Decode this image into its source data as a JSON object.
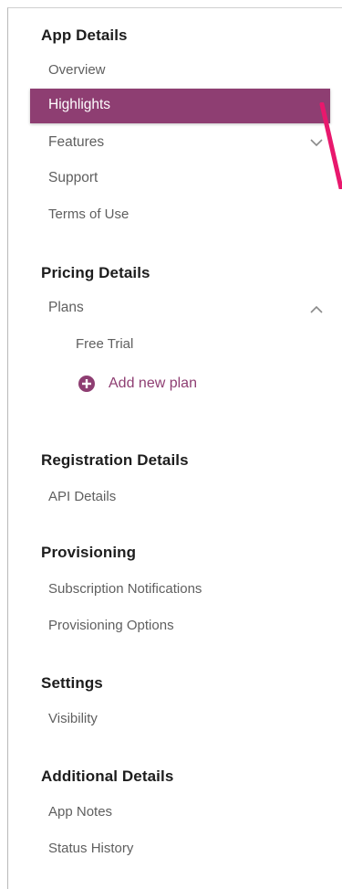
{
  "sections": {
    "app_details": {
      "title": "App Details",
      "items": [
        "Overview",
        "Highlights",
        "Features",
        "Support",
        "Terms of Use"
      ]
    },
    "pricing_details": {
      "title": "Pricing Details",
      "items": [
        "Plans",
        "Free Trial"
      ],
      "add_plan_label": "Add new plan"
    },
    "registration_details": {
      "title": "Registration Details",
      "items": [
        "API Details"
      ]
    },
    "provisioning": {
      "title": "Provisioning",
      "items": [
        "Subscription Notifications",
        "Provisioning Options"
      ]
    },
    "settings": {
      "title": "Settings",
      "items": [
        "Visibility"
      ]
    },
    "additional_details": {
      "title": "Additional Details",
      "items": [
        "App Notes",
        "Status History"
      ]
    }
  },
  "colors": {
    "accent": "#8e3e72",
    "annotation": "#e8186d"
  },
  "icons": {
    "features_toggle": "chevron-down-icon",
    "plans_toggle": "chevron-up-icon",
    "add_plan": "plus-circle-icon"
  }
}
